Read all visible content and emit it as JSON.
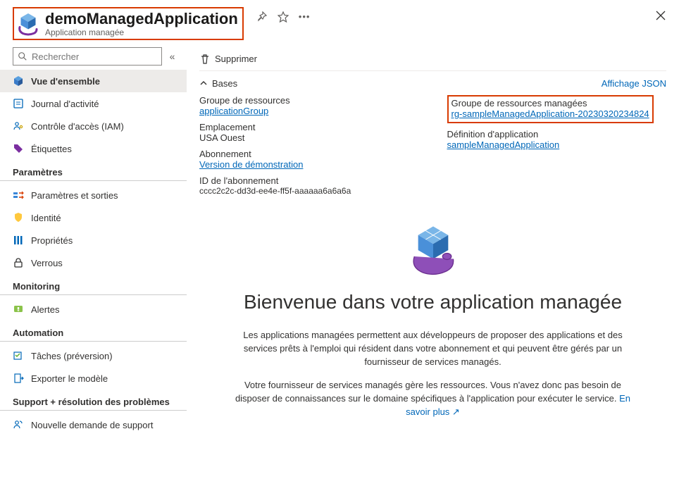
{
  "header": {
    "title": "demoManagedApplication",
    "subtitle": "Application managée"
  },
  "sidebar": {
    "search_placeholder": "Rechercher",
    "items_top": [
      {
        "label": "Vue d'ensemble"
      },
      {
        "label": "Journal d'activité"
      },
      {
        "label": "Contrôle d'accès (IAM)"
      },
      {
        "label": "Étiquettes"
      }
    ],
    "sections": [
      {
        "title": "Paramètres",
        "items": [
          {
            "label": "Paramètres et sorties"
          },
          {
            "label": "Identité"
          },
          {
            "label": "Propriétés"
          },
          {
            "label": "Verrous"
          }
        ]
      },
      {
        "title": "Monitoring",
        "items": [
          {
            "label": "Alertes"
          }
        ]
      },
      {
        "title": "Automation",
        "items": [
          {
            "label": "Tâches (préversion)"
          },
          {
            "label": "Exporter le modèle"
          }
        ]
      },
      {
        "title": "Support + résolution des problèmes",
        "items": [
          {
            "label": "Nouvelle demande de support"
          }
        ]
      }
    ]
  },
  "toolbar": {
    "delete_label": "Supprimer"
  },
  "essentials": {
    "header": "Bases",
    "json_link": "Affichage JSON",
    "left": [
      {
        "label": "Groupe de ressources",
        "value": "applicationGroup",
        "is_link": true
      },
      {
        "label": "Emplacement",
        "value": "USA Ouest"
      },
      {
        "label": "Abonnement",
        "value": "Version de démonstration",
        "is_link": true
      },
      {
        "label": "ID de l'abonnement",
        "value": "cccc2c2c-dd3d-ee4e-ff5f-aaaaaa6a6a6a"
      }
    ],
    "right": [
      {
        "label": "Groupe de ressources managées",
        "value": "rg-sampleManagedApplication-20230320234824",
        "is_link": true,
        "highlight": true
      },
      {
        "label": "Définition d'application",
        "value": "sampleManagedApplication",
        "is_link": true
      }
    ]
  },
  "welcome": {
    "title": "Bienvenue dans votre application managée",
    "p1": "Les applications managées permettent aux développeurs de proposer des applications et des services prêts à l'emploi qui résident dans votre abonnement et qui peuvent être gérés par un fournisseur de services managés.",
    "p2": "Votre fournisseur de services managés gère les ressources. Vous n'avez donc pas besoin de disposer de connaissances sur le domaine spécifiques à l'application pour exécuter le service.",
    "learn_more": "En savoir plus"
  }
}
